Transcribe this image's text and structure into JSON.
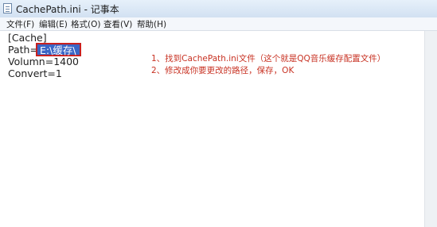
{
  "window": {
    "title": "CachePath.ini - 记事本"
  },
  "menu": {
    "items": [
      "文件(F)",
      "编辑(E)",
      "格式(O)",
      "查看(V)",
      "帮助(H)"
    ]
  },
  "editor": {
    "lines": [
      "[Cache]",
      "Path=",
      "Volumn=1400",
      "Convert=1"
    ],
    "selected_value": "E:\\缓存\\"
  },
  "annotations": {
    "step1": "1、找到CachePath.ini文件（这个就是QQ音乐缓存配置文件）",
    "step2": "2、修改成你要更改的路径，保存，OK"
  },
  "colors": {
    "annotation_text": "#c83223",
    "selection_background": "#3a66c6",
    "highlight_border": "#c8201f"
  }
}
